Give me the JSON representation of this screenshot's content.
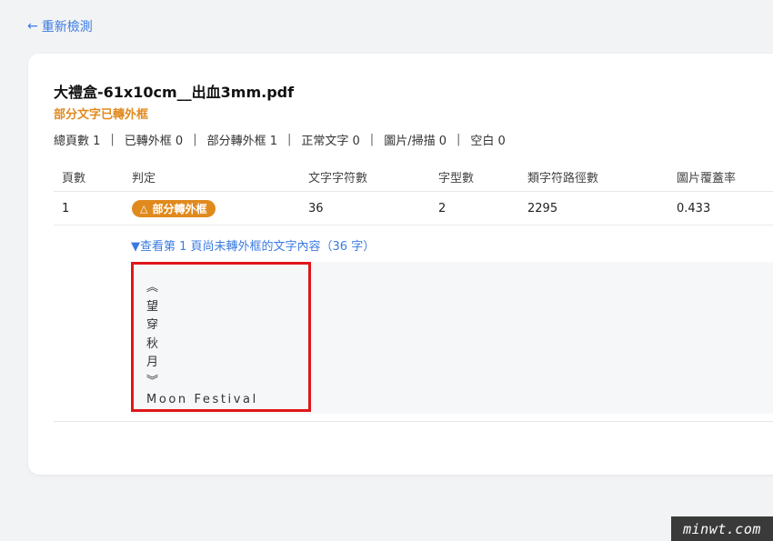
{
  "back_link": {
    "arrow": "←",
    "label": "重新檢測"
  },
  "file": {
    "title": "大禮盒-61x10cm__出血3mm.pdf",
    "status": "部分文字已轉外框"
  },
  "summary": [
    {
      "label": "總頁數",
      "value": "1"
    },
    {
      "label": "已轉外框",
      "value": "0"
    },
    {
      "label": "部分轉外框",
      "value": "1"
    },
    {
      "label": "正常文字",
      "value": "0"
    },
    {
      "label": "圖片/掃描",
      "value": "0"
    },
    {
      "label": "空白",
      "value": "0"
    }
  ],
  "summary_text": [
    "總頁數 1",
    "已轉外框 0",
    "部分轉外框 1",
    "正常文字 0",
    "圖片/掃描 0",
    "空白 0"
  ],
  "table": {
    "headers": [
      "頁數",
      "判定",
      "文字字符數",
      "字型數",
      "類字符路徑數",
      "圖片覆蓋率"
    ],
    "rows": [
      {
        "page": "1",
        "verdict": "部分轉外框",
        "verdict_icon": "△",
        "char_count": "36",
        "font_count": "2",
        "glyph_path_count": "2295",
        "image_coverage": "0.433"
      }
    ]
  },
  "toggle": {
    "label": "▼查看第 1 頁尚未轉外框的文字內容（36 字）"
  },
  "extracted_text": [
    "︽",
    "望",
    "穿",
    "秋",
    "月",
    "︾",
    "Moon Festival"
  ],
  "watermark": "minwt.com",
  "colors": {
    "accent_blue": "#3b7be0",
    "warning_orange": "#e08a1e",
    "highlight_red": "#e0161b"
  }
}
